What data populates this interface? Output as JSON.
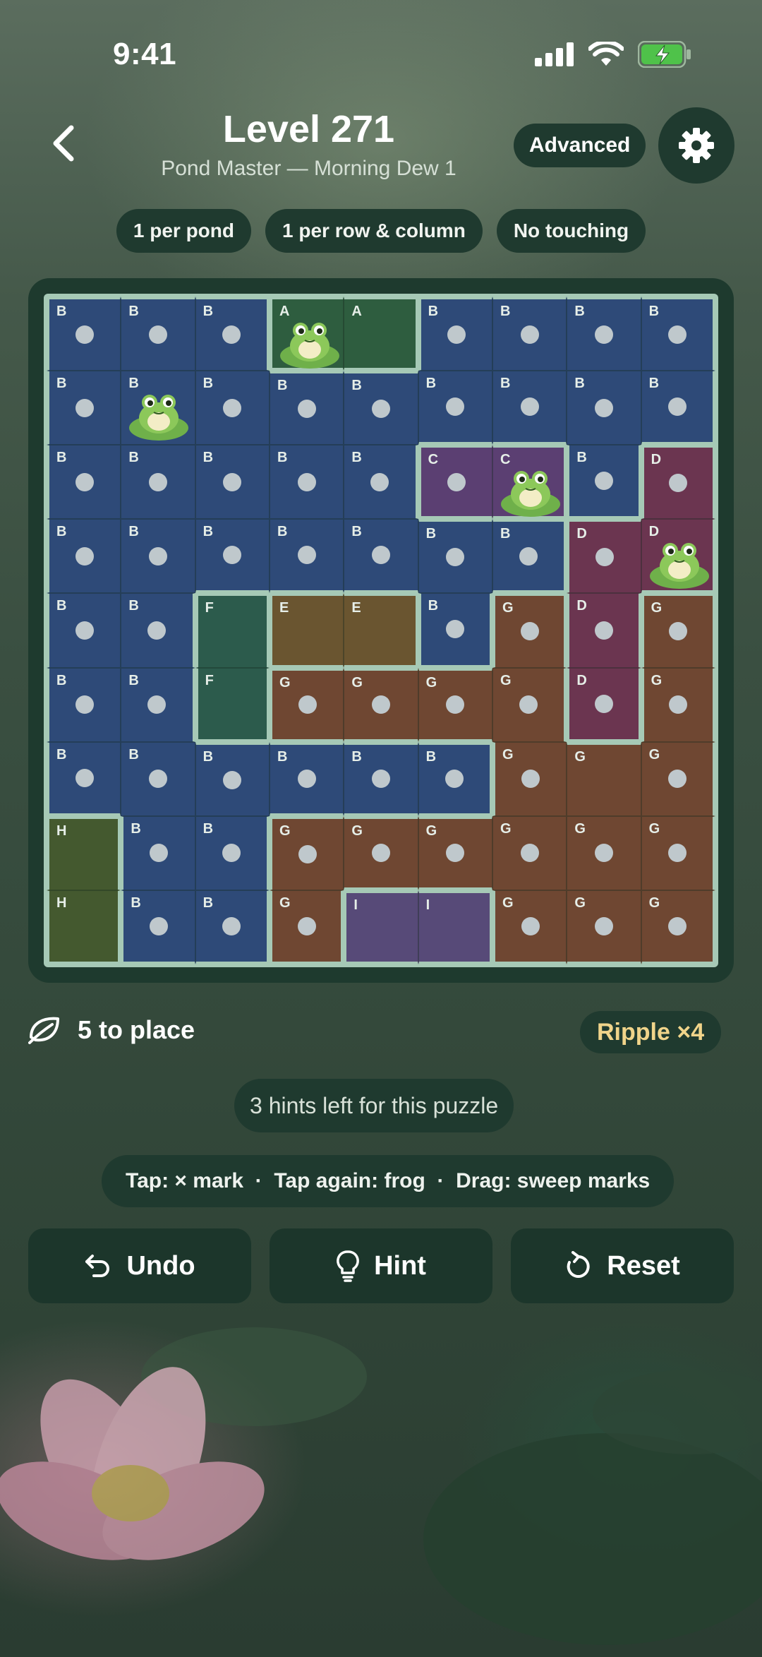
{
  "status": {
    "time": "9:41"
  },
  "header": {
    "title": "Level 271",
    "subtitle": "Pond Master — Morning Dew 1",
    "difficulty": "Advanced"
  },
  "rules": [
    "1 per pond",
    "1 per row & column",
    "No touching"
  ],
  "board": {
    "rows": [
      [
        "B",
        "B",
        "B",
        "A",
        "A",
        "B",
        "B",
        "B",
        "B"
      ],
      [
        "B",
        "B",
        "B",
        "B",
        "B",
        "B",
        "B",
        "B",
        "B"
      ],
      [
        "B",
        "B",
        "B",
        "B",
        "B",
        "C",
        "C",
        "B",
        "D"
      ],
      [
        "B",
        "B",
        "B",
        "B",
        "B",
        "B",
        "B",
        "D",
        "D"
      ],
      [
        "B",
        "B",
        "F",
        "E",
        "E",
        "B",
        "G",
        "D",
        "G"
      ],
      [
        "B",
        "B",
        "F",
        "G",
        "G",
        "G",
        "G",
        "D",
        "G"
      ],
      [
        "B",
        "B",
        "B",
        "B",
        "B",
        "B",
        "G",
        "G",
        "G"
      ],
      [
        "H",
        "B",
        "B",
        "G",
        "G",
        "G",
        "G",
        "G",
        "G"
      ],
      [
        "H",
        "B",
        "B",
        "G",
        "I",
        "I",
        "G",
        "G",
        "G"
      ]
    ],
    "frogs": [
      [
        0,
        3
      ],
      [
        1,
        1
      ],
      [
        2,
        6
      ],
      [
        3,
        8
      ]
    ],
    "empty": [
      [
        0,
        4
      ],
      [
        4,
        2
      ],
      [
        4,
        3
      ],
      [
        4,
        4
      ],
      [
        5,
        2
      ],
      [
        6,
        7
      ],
      [
        7,
        0
      ],
      [
        8,
        0
      ],
      [
        8,
        4
      ],
      [
        8,
        5
      ]
    ],
    "region_colors": {
      "A": "#2e5d3f",
      "B": "#2e4a78",
      "C": "#5b3f72",
      "D": "#6b3550",
      "E": "#6a5530",
      "F": "#2c5b4c",
      "G": "#6f4732",
      "H": "#44592f",
      "I": "#574a78"
    }
  },
  "footer": {
    "to_place": "5 to place",
    "ripple": "Ripple ×4",
    "hints": "3 hints left for this puzzle",
    "help": "Tap: × mark  ·  Tap again: frog  ·  Drag: sweep marks"
  },
  "actions": {
    "undo": "Undo",
    "hint": "Hint",
    "reset": "Reset"
  },
  "icons": {
    "back": "chevron-left-icon",
    "settings": "gear-icon",
    "leaf": "leaf-icon",
    "undo": "undo-icon",
    "hint": "lightbulb-icon",
    "reset": "reset-icon"
  }
}
